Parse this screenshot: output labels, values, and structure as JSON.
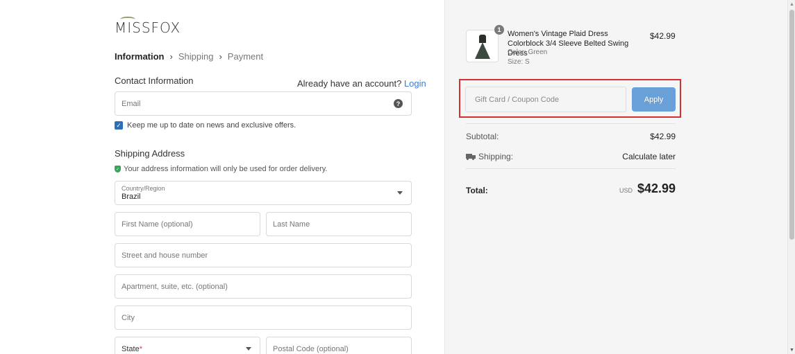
{
  "brand": {
    "logo_text": "MISSFOX"
  },
  "breadcrumb": {
    "steps": [
      "Information",
      "Shipping",
      "Payment"
    ]
  },
  "contact": {
    "title": "Contact Information",
    "account_prompt": "Already have an account?",
    "login_label": "Login",
    "email_placeholder": "Email",
    "newsletter_label": "Keep me up to date on news and exclusive offers."
  },
  "shipping": {
    "title": "Shipping Address",
    "privacy_note": "Your address information will only be used for order delivery.",
    "country_label": "Country/Region",
    "country_value": "Brazil",
    "first_name_placeholder": "First Name (optional)",
    "last_name_placeholder": "Last Name",
    "street_placeholder": "Street and house number",
    "apartment_placeholder": "Apartment, suite, etc. (optional)",
    "city_placeholder": "City",
    "state_label": "State",
    "state_required_mark": "*",
    "postal_placeholder": "Postal Code (optional)"
  },
  "order": {
    "item": {
      "quantity": "1",
      "name": "Women's Vintage Plaid Dress Colorblock 3/4 Sleeve Belted Swing Dress",
      "color": "Color: Green",
      "size": "Size: S",
      "price": "$42.99"
    },
    "coupon": {
      "placeholder": "Gift Card / Coupon Code",
      "apply_label": "Apply"
    },
    "subtotal_label": "Subtotal:",
    "subtotal_value": "$42.99",
    "shipping_label": "Shipping:",
    "shipping_value": "Calculate later",
    "total_label": "Total:",
    "total_currency": "USD",
    "total_value": "$42.99"
  },
  "colors": {
    "accent": "#3a7bd5",
    "apply_button": "#6aa0d8",
    "highlight": "#d32f2f",
    "checkbox": "#2d6fb7",
    "shield": "#3aa45b"
  },
  "icons": [
    "help-icon",
    "caret-down-icon",
    "checkbox-checked-icon",
    "shield-check-icon",
    "truck-icon",
    "chevron-right-icon"
  ]
}
